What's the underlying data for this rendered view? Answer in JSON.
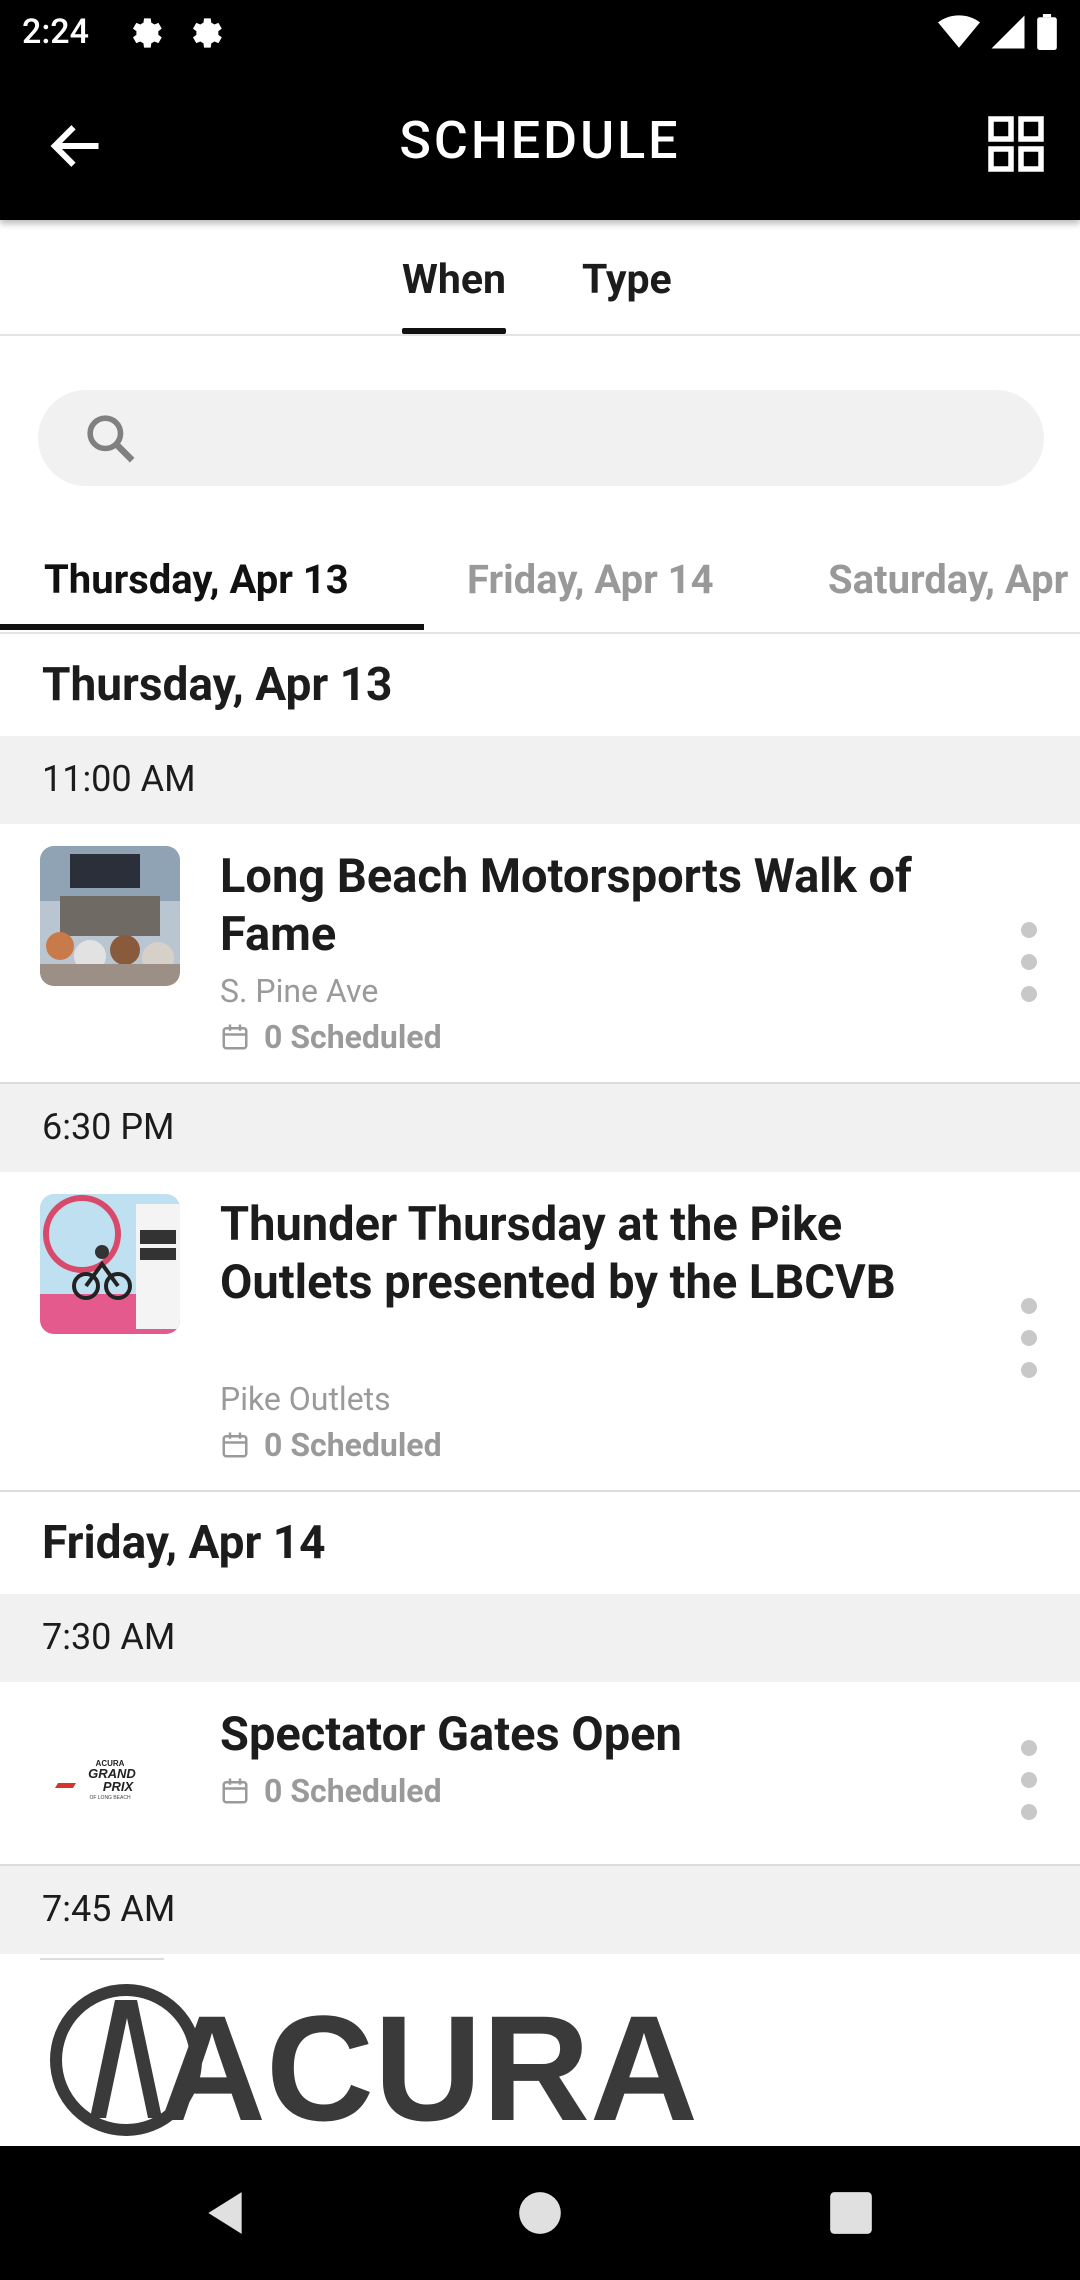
{
  "status_bar": {
    "time": "2:24"
  },
  "app_bar": {
    "title": "SCHEDULE"
  },
  "view_tabs": [
    {
      "label": "When"
    },
    {
      "label": "Type"
    }
  ],
  "search": {
    "placeholder": ""
  },
  "day_tabs": [
    {
      "label": "Thursday, Apr 13"
    },
    {
      "label": "Friday, Apr 14"
    },
    {
      "label": "Saturday, Apr"
    }
  ],
  "days": [
    {
      "header": "Thursday, Apr 13",
      "slots": [
        {
          "time": "11:00 AM",
          "event": {
            "title": "Long Beach Motorsports Walk of Fame",
            "location": "S. Pine Ave",
            "scheduled": "0 Scheduled"
          }
        },
        {
          "time": "6:30 PM",
          "event": {
            "title": "Thunder Thursday at the Pike Outlets presented by the LBCVB",
            "location": "Pike Outlets",
            "scheduled": "0 Scheduled"
          }
        }
      ]
    },
    {
      "header": "Friday, Apr 14",
      "slots": [
        {
          "time": "7:30 AM",
          "event": {
            "title": "Spectator Gates Open",
            "scheduled": "0 Scheduled"
          }
        },
        {
          "time": "7:45 AM"
        }
      ]
    }
  ],
  "thumb_logo": {
    "brand": "ACURA",
    "line1": "GRAND",
    "line2": "PRIX",
    "line3": "OF LONG BEACH"
  },
  "banner": {
    "brand": "ACURA"
  }
}
